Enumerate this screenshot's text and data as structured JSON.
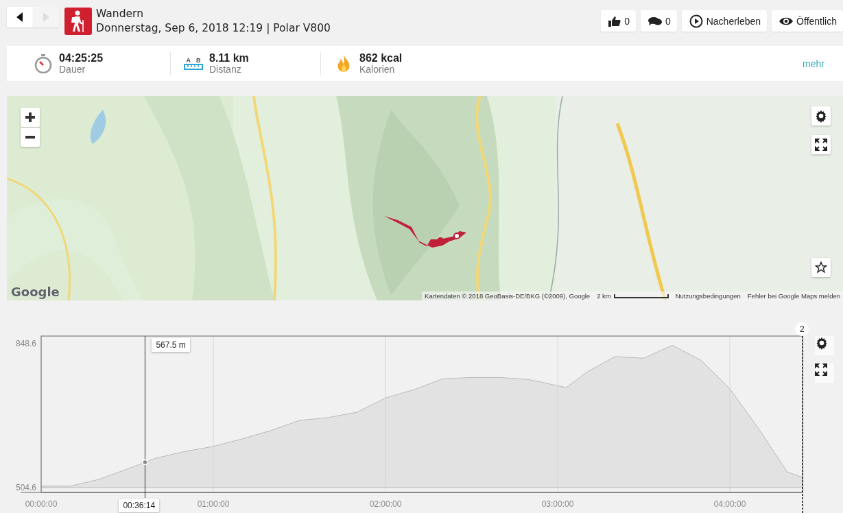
{
  "nav": [
    {
      "kind": "back",
      "disabled": false
    },
    {
      "kind": "forward",
      "disabled": true
    }
  ],
  "activity": {
    "title": "Wandern",
    "subtitle": "Donnerstag, Sep 6, 2018 12:19 | Polar V800"
  },
  "actions": [
    {
      "kind": "like",
      "label": "0"
    },
    {
      "kind": "comment",
      "label": "0"
    },
    {
      "kind": "replay",
      "label": "Nacherleben"
    },
    {
      "kind": "visibility",
      "label": "Öffentlich"
    }
  ],
  "stats": [
    {
      "kind": "duration",
      "value": "04:25:25",
      "label": "Dauer"
    },
    {
      "kind": "distance",
      "value": "8.11 km",
      "label": "Distanz",
      "icon_letters": [
        "A",
        "B"
      ]
    },
    {
      "kind": "calories",
      "value": "862 kcal",
      "label": "Kalorien"
    }
  ],
  "more_link": "mehr",
  "map": {
    "kind": "picture",
    "logo": "Google",
    "attribution": "Kartendaten © 2018 GeoBasis-DE/BKG (©2009), Google",
    "scale": "2 km",
    "terms": "Nutzungsbedingungen",
    "report": "Fehler bei Google Maps melden"
  },
  "chart": {
    "chart_data": {
      "type": "area",
      "x": [
        0,
        10,
        20,
        30,
        40,
        50,
        60,
        70,
        80,
        90,
        100,
        110,
        120,
        130,
        140,
        150,
        160,
        170,
        183,
        190,
        200,
        210,
        220,
        230,
        240,
        250,
        260,
        265.4
      ],
      "series": [
        {
          "color": "#888888",
          "values": [
            508,
            508,
            524,
            549,
            575,
            591,
            603,
            621,
            641,
            665,
            672,
            685,
            719,
            739,
            765,
            768,
            768,
            763,
            744,
            780,
            818,
            814,
            845,
            809,
            741,
            646,
            542,
            529
          ]
        }
      ],
      "xlim": [
        0,
        265.4
      ],
      "ylim": [
        493,
        867
      ],
      "grid": true,
      "ref_lines": [
        {
          "axis": "x",
          "value": 36.2
        },
        {
          "axis": "y",
          "value": 504.6
        }
      ],
      "xticks": [
        {
          "value": 0,
          "label": "00:00:00"
        },
        {
          "value": 60,
          "label": "01:00:00"
        },
        {
          "value": 120,
          "label": "02:00:00"
        },
        {
          "value": 180,
          "label": "03:00:00"
        },
        {
          "value": 240,
          "label": "04:00:00"
        }
      ],
      "yticks": [
        504.6,
        848.6
      ]
    },
    "cursor_value": "567.5 m",
    "cursor_time": "00:36:14",
    "end_marker": "2"
  }
}
